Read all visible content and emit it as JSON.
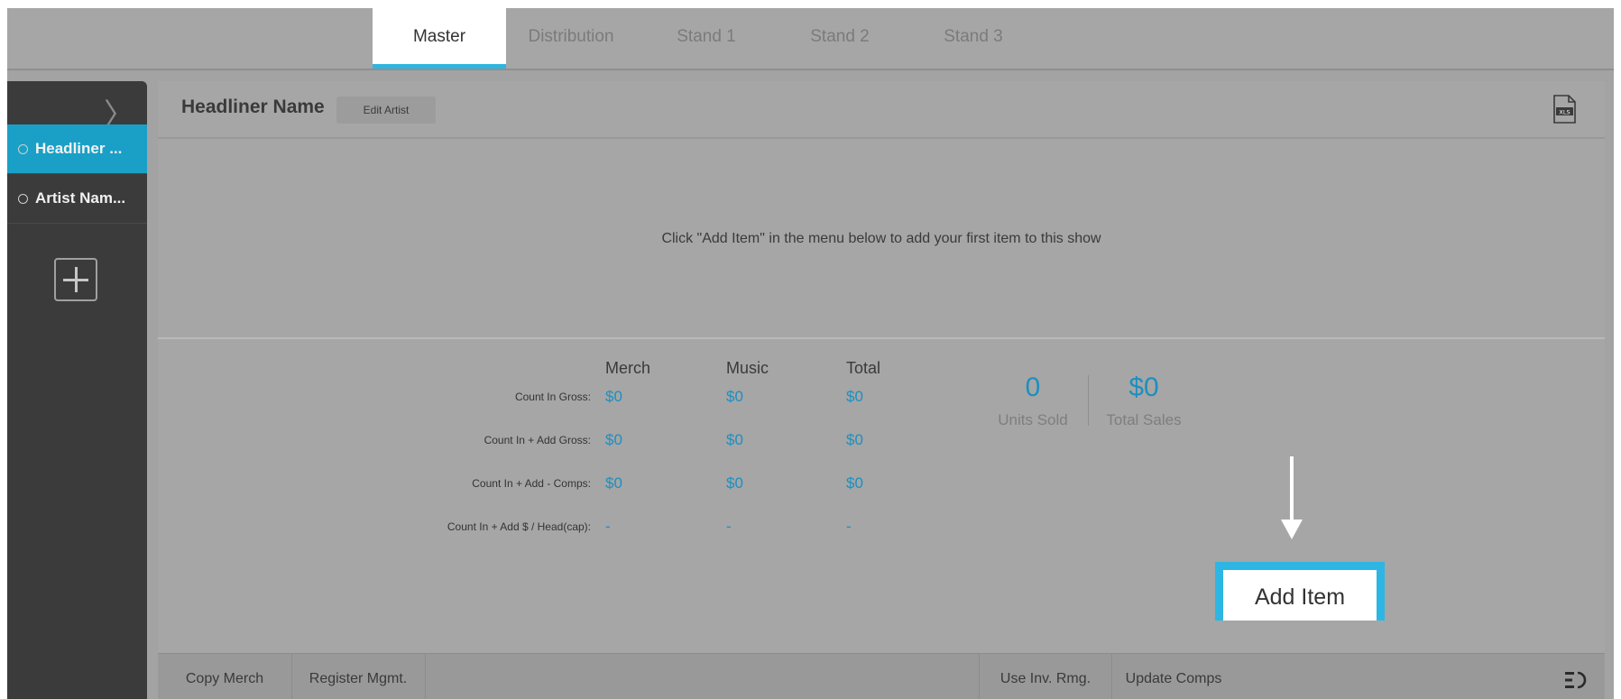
{
  "tabs": [
    {
      "label": "Master",
      "active": true
    },
    {
      "label": "Distribution",
      "active": false
    },
    {
      "label": "Stand 1",
      "active": false
    },
    {
      "label": "Stand 2",
      "active": false
    },
    {
      "label": "Stand 3",
      "active": false
    }
  ],
  "sidebar": {
    "toggle_glyph": "〉",
    "artists": [
      {
        "label": "Headliner ...",
        "selected": true
      },
      {
        "label": "Artist Nam...",
        "selected": false
      }
    ],
    "add_icon": "plus-icon"
  },
  "header": {
    "title": "Headliner Name",
    "edit_button": "Edit Artist",
    "export_icon": "xls-file-icon",
    "export_icon_text": "XLS"
  },
  "empty_message": "Click \"Add Item\" in the menu below to add your first item to this show",
  "summary": {
    "columns": [
      "Merch",
      "Music",
      "Total"
    ],
    "rows": [
      {
        "label": "Count In Gross:",
        "values": [
          "$0",
          "$0",
          "$0"
        ]
      },
      {
        "label": "Count In + Add Gross:",
        "values": [
          "$0",
          "$0",
          "$0"
        ]
      },
      {
        "label": "Count In + Add - Comps:",
        "values": [
          "$0",
          "$0",
          "$0"
        ]
      },
      {
        "label": "Count In + Add $ / Head(cap):",
        "values": [
          "-",
          "-",
          "-"
        ]
      }
    ],
    "units_sold": {
      "value": "0",
      "label": "Units Sold"
    },
    "total_sales": {
      "value": "$0",
      "label": "Total Sales"
    }
  },
  "toolbar": {
    "copy_merch": "Copy Merch",
    "register_mgmt": "Register Mgmt.",
    "use_inv_rmg": "Use Inv. Rmg.",
    "update_comps": "Update Comps",
    "add_item": "Add Item",
    "menu_icon": "menu-collapse-icon"
  },
  "colors": {
    "accent": "#2fb6e0",
    "value_blue": "#1d8fbf",
    "sidebar_bg": "#3b3b3b",
    "overlay_gray": "#a6a6a6"
  }
}
